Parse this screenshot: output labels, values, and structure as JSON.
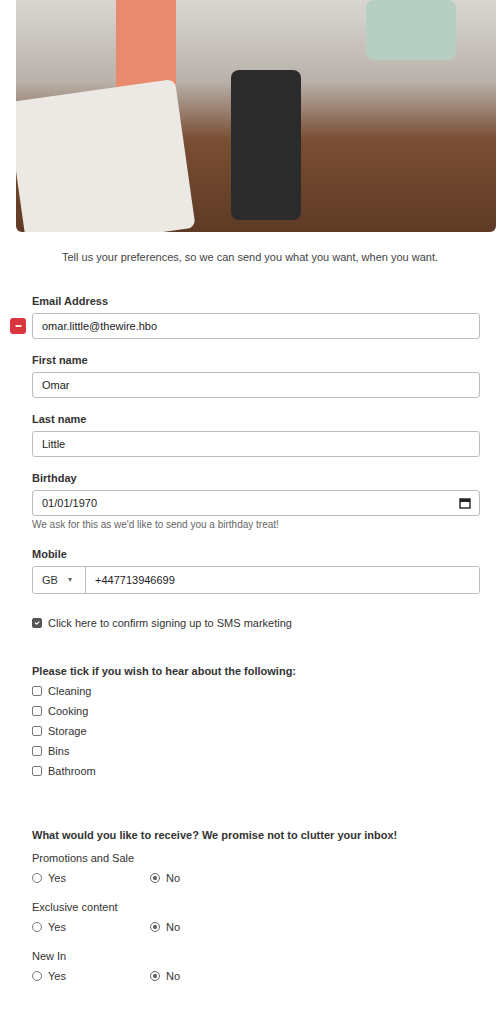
{
  "intro": "Tell us your preferences, so we can send you what you want, when you want.",
  "autofill_badge": "•••",
  "fields": [
    {
      "kind": "text",
      "label": "Email Address",
      "value": "omar.little@thewire.hbo"
    },
    {
      "kind": "text",
      "label": "First name",
      "value": "Omar"
    },
    {
      "kind": "text",
      "label": "Last name",
      "value": "Little"
    },
    {
      "kind": "date",
      "label": "Birthday",
      "value": "01/01/1970",
      "help": "We ask for this as we'd like to send you a birthday treat!"
    },
    {
      "kind": "phone",
      "label": "Mobile",
      "country": "GB",
      "country_arrow": "▾",
      "value": "+447713946699"
    }
  ],
  "sms_consent": {
    "label": "Click here to confirm signing up to SMS marketing",
    "checked": true
  },
  "interests": {
    "heading": "Please tick if you wish to hear about the following:",
    "items": [
      {
        "label": "Cleaning",
        "checked": false
      },
      {
        "label": "Cooking",
        "checked": false
      },
      {
        "label": "Storage",
        "checked": false
      },
      {
        "label": "Bins",
        "checked": false
      },
      {
        "label": "Bathroom",
        "checked": false
      }
    ]
  },
  "preferences": {
    "heading": "What would you like to receive? We promise not to clutter your inbox!",
    "groups": [
      {
        "label": "Promotions and Sale",
        "options": [
          {
            "label": "Yes",
            "selected": false
          },
          {
            "label": "No",
            "selected": true
          }
        ]
      },
      {
        "label": "Exclusive content",
        "options": [
          {
            "label": "Yes",
            "selected": false
          },
          {
            "label": "No",
            "selected": true
          }
        ]
      },
      {
        "label": "New In",
        "options": [
          {
            "label": "Yes",
            "selected": false
          },
          {
            "label": "No",
            "selected": true
          }
        ]
      }
    ]
  }
}
